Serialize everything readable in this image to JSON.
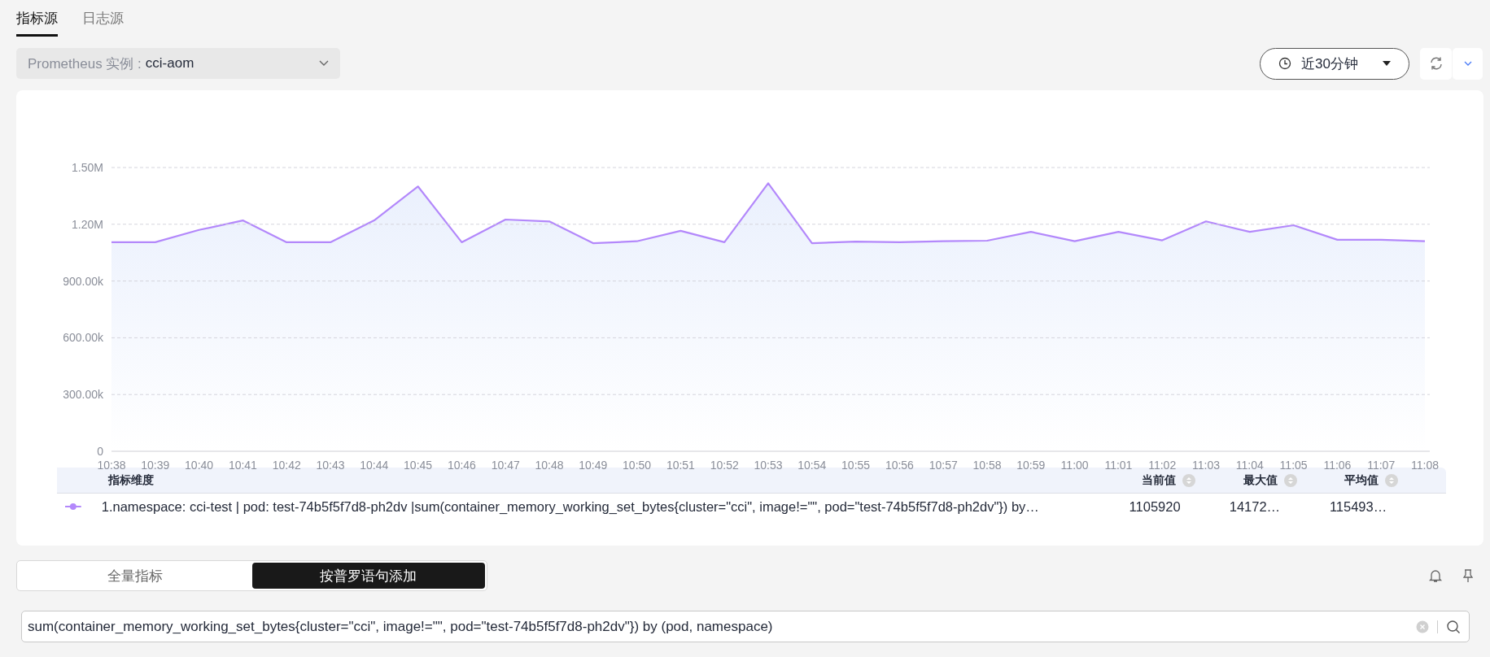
{
  "tabs": [
    {
      "label": "指标源",
      "selected": true
    },
    {
      "label": "日志源",
      "selected": false
    }
  ],
  "instance_select": {
    "label": "Prometheus 实例 :",
    "value": "cci-aom"
  },
  "time_range": {
    "value": "近30分钟"
  },
  "chart": {
    "chart_data": {
      "type": "area",
      "categories": [
        "10:38",
        "10:39",
        "10:40",
        "10:41",
        "10:42",
        "10:43",
        "10:44",
        "10:45",
        "10:46",
        "10:47",
        "10:48",
        "10:49",
        "10:50",
        "10:51",
        "10:52",
        "10:53",
        "10:54",
        "10:55",
        "10:56",
        "10:57",
        "10:58",
        "10:59",
        "11:00",
        "11:01",
        "11:02",
        "11:03",
        "11:04",
        "11:05",
        "11:06",
        "11:07",
        "11:08"
      ],
      "series": [
        {
          "name": "1.namespace: cci-test | pod: test-74b5f5f7d8-ph2dv |sum(container_memory_working_set_bytes{cluster=\"cci\", image!=\"\", pod=\"test-74b5f5f7d8-ph2dv\"}) by…",
          "color": "#b388fb",
          "values": [
            1105000,
            1105000,
            1170000,
            1220000,
            1105000,
            1105000,
            1220000,
            1400000,
            1105000,
            1225000,
            1215000,
            1100000,
            1110000,
            1165000,
            1105000,
            1417000,
            1100000,
            1108000,
            1105000,
            1110000,
            1113000,
            1160000,
            1110000,
            1160000,
            1115000,
            1215000,
            1160000,
            1195000,
            1118000,
            1118000,
            1110000
          ]
        }
      ],
      "ylim": [
        0,
        1500000
      ],
      "grid": true,
      "yticks": [
        {
          "value": 0,
          "label": "0"
        },
        {
          "value": 300000,
          "label": "300.00k"
        },
        {
          "value": 600000,
          "label": "600.00k"
        },
        {
          "value": 900000,
          "label": "900.00k"
        },
        {
          "value": 1200000,
          "label": "1.20M"
        },
        {
          "value": 1500000,
          "label": "1.50M"
        }
      ]
    }
  },
  "legend": {
    "columns": [
      "指标维度",
      "当前值",
      "最大值",
      "平均值"
    ],
    "rows": [
      {
        "current": "1105920",
        "max": "14172…",
        "avg": "115493…"
      }
    ]
  },
  "mode_toggle": [
    {
      "label": "全量指标",
      "selected": false
    },
    {
      "label": "按普罗语句添加",
      "selected": true
    }
  ],
  "query": {
    "value": "sum(container_memory_working_set_bytes{cluster=\"cci\", image!=\"\", pod=\"test-74b5f5f7d8-ph2dv\"}) by (pod, namespace)"
  }
}
